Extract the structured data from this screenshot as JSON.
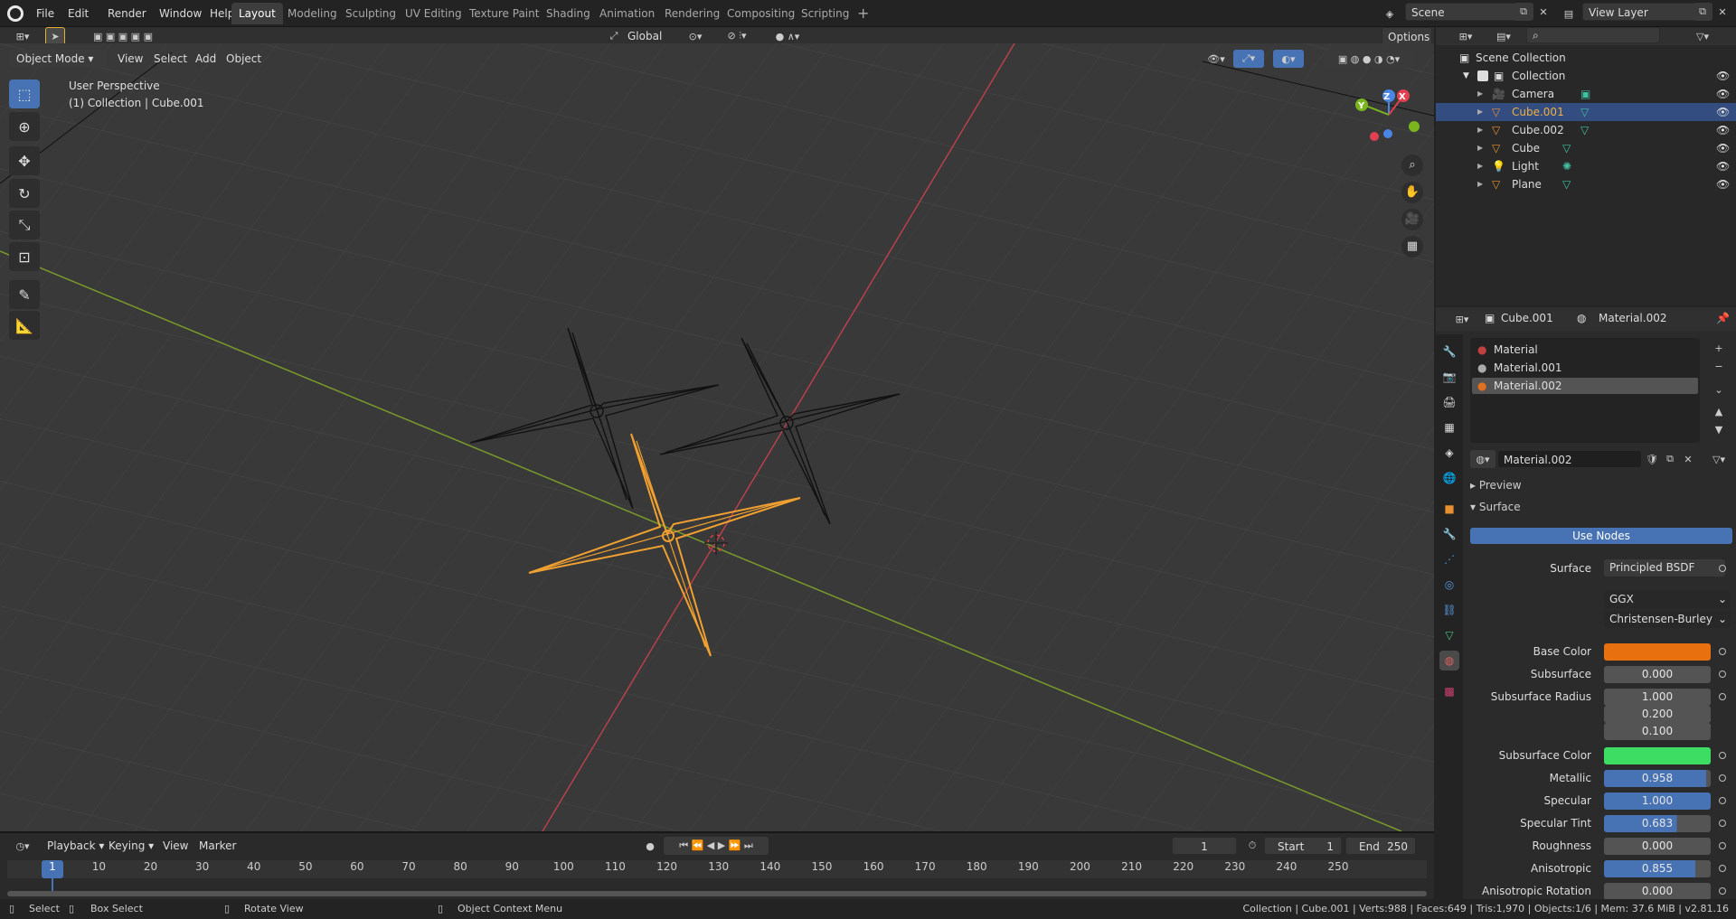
{
  "menu": {
    "file": "File",
    "edit": "Edit",
    "render": "Render",
    "window": "Window",
    "help": "Help"
  },
  "workspaces": [
    "Layout",
    "Modeling",
    "Sculpting",
    "UV Editing",
    "Texture Paint",
    "Shading",
    "Animation",
    "Rendering",
    "Compositing",
    "Scripting"
  ],
  "active_workspace": "Layout",
  "scene": {
    "name": "Scene",
    "view_layer": "View Layer"
  },
  "viewport_header": {
    "mode": "Object Mode",
    "view": "View",
    "select": "Select",
    "add": "Add",
    "object": "Object",
    "orientation": "Global",
    "options": "Options"
  },
  "viewport": {
    "perspective": "User Perspective",
    "context": "(1) Collection | Cube.001",
    "gizmo": {
      "x": "X",
      "y": "Y",
      "z": "Z"
    }
  },
  "outliner": {
    "root": "Scene Collection",
    "collection": "Collection",
    "items": [
      {
        "label": "Camera",
        "selected": false
      },
      {
        "label": "Cube.001",
        "selected": true
      },
      {
        "label": "Cube.002",
        "selected": false
      },
      {
        "label": "Cube",
        "selected": false
      },
      {
        "label": "Light",
        "selected": false
      },
      {
        "label": "Plane",
        "selected": false
      }
    ]
  },
  "properties": {
    "object": "Cube.001",
    "material": "Material.002",
    "slots": [
      "Material",
      "Material.001",
      "Material.002"
    ],
    "active_slot": "Material.002",
    "preview": "Preview",
    "surface_panel": "Surface",
    "use_nodes": "Use Nodes",
    "surface_label": "Surface",
    "surface_value": "Principled BSDF",
    "distribution": "GGX",
    "subsurface_method": "Christensen-Burley",
    "fields": [
      {
        "label": "Base Color",
        "value": "",
        "color": "#e8700f"
      },
      {
        "label": "Subsurface",
        "value": "0.000",
        "fill": 0
      },
      {
        "label": "Subsurface Radius",
        "value": "1.000",
        "fill": 0
      },
      {
        "label": "",
        "value": "0.200",
        "fill": 0
      },
      {
        "label": "",
        "value": "0.100",
        "fill": 0
      },
      {
        "label": "Subsurface Color",
        "value": "",
        "color": "#3ddc63"
      },
      {
        "label": "Metallic",
        "value": "0.958",
        "fill": 0.958
      },
      {
        "label": "Specular",
        "value": "1.000",
        "fill": 1.0
      },
      {
        "label": "Specular Tint",
        "value": "0.683",
        "fill": 0.683
      },
      {
        "label": "Roughness",
        "value": "0.000",
        "fill": 0
      },
      {
        "label": "Anisotropic",
        "value": "0.855",
        "fill": 0.855
      },
      {
        "label": "Anisotropic Rotation",
        "value": "0.000",
        "fill": 0
      }
    ]
  },
  "timeline": {
    "playback": "Playback",
    "keying": "Keying",
    "view": "View",
    "marker": "Marker",
    "current_frame": "1",
    "start_label": "Start",
    "start": "1",
    "end_label": "End",
    "end": "250",
    "ticks": [
      "1",
      "10",
      "20",
      "30",
      "40",
      "50",
      "60",
      "70",
      "80",
      "90",
      "100",
      "110",
      "120",
      "130",
      "140",
      "150",
      "160",
      "170",
      "180",
      "190",
      "200",
      "210",
      "220",
      "230",
      "240",
      "250"
    ]
  },
  "statusbar": {
    "select": "Select",
    "box_select": "Box Select",
    "rotate_view": "Rotate View",
    "context_menu": "Object Context Menu",
    "stats": "Collection | Cube.001 | Verts:988 | Faces:649 | Tris:1,970 | Objects:1/6 | Mem: 37.6 MiB | v2.81.16"
  }
}
